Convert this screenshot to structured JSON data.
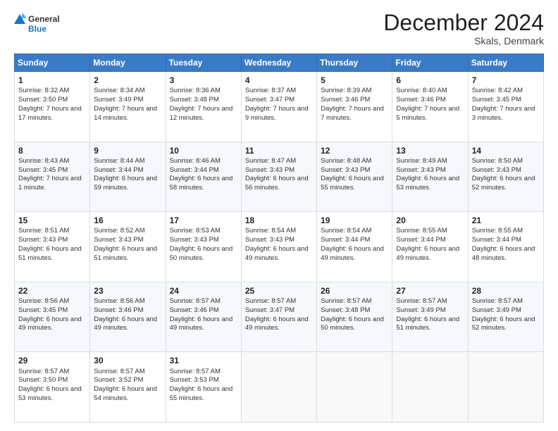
{
  "logo": {
    "line1": "General",
    "line2": "Blue"
  },
  "header": {
    "month": "December 2024",
    "location": "Skals, Denmark"
  },
  "days": [
    "Sunday",
    "Monday",
    "Tuesday",
    "Wednesday",
    "Thursday",
    "Friday",
    "Saturday"
  ],
  "weeks": [
    [
      {
        "day": "1",
        "sunrise": "8:32 AM",
        "sunset": "3:50 PM",
        "daylight": "7 hours and 17 minutes."
      },
      {
        "day": "2",
        "sunrise": "8:34 AM",
        "sunset": "3:49 PM",
        "daylight": "7 hours and 14 minutes."
      },
      {
        "day": "3",
        "sunrise": "8:36 AM",
        "sunset": "3:48 PM",
        "daylight": "7 hours and 12 minutes."
      },
      {
        "day": "4",
        "sunrise": "8:37 AM",
        "sunset": "3:47 PM",
        "daylight": "7 hours and 9 minutes."
      },
      {
        "day": "5",
        "sunrise": "8:39 AM",
        "sunset": "3:46 PM",
        "daylight": "7 hours and 7 minutes."
      },
      {
        "day": "6",
        "sunrise": "8:40 AM",
        "sunset": "3:46 PM",
        "daylight": "7 hours and 5 minutes."
      },
      {
        "day": "7",
        "sunrise": "8:42 AM",
        "sunset": "3:45 PM",
        "daylight": "7 hours and 3 minutes."
      }
    ],
    [
      {
        "day": "8",
        "sunrise": "8:43 AM",
        "sunset": "3:45 PM",
        "daylight": "7 hours and 1 minute."
      },
      {
        "day": "9",
        "sunrise": "8:44 AM",
        "sunset": "3:44 PM",
        "daylight": "6 hours and 59 minutes."
      },
      {
        "day": "10",
        "sunrise": "8:46 AM",
        "sunset": "3:44 PM",
        "daylight": "6 hours and 58 minutes."
      },
      {
        "day": "11",
        "sunrise": "8:47 AM",
        "sunset": "3:43 PM",
        "daylight": "6 hours and 56 minutes."
      },
      {
        "day": "12",
        "sunrise": "8:48 AM",
        "sunset": "3:43 PM",
        "daylight": "6 hours and 55 minutes."
      },
      {
        "day": "13",
        "sunrise": "8:49 AM",
        "sunset": "3:43 PM",
        "daylight": "6 hours and 53 minutes."
      },
      {
        "day": "14",
        "sunrise": "8:50 AM",
        "sunset": "3:43 PM",
        "daylight": "6 hours and 52 minutes."
      }
    ],
    [
      {
        "day": "15",
        "sunrise": "8:51 AM",
        "sunset": "3:43 PM",
        "daylight": "6 hours and 51 minutes."
      },
      {
        "day": "16",
        "sunrise": "8:52 AM",
        "sunset": "3:43 PM",
        "daylight": "6 hours and 51 minutes."
      },
      {
        "day": "17",
        "sunrise": "8:53 AM",
        "sunset": "3:43 PM",
        "daylight": "6 hours and 50 minutes."
      },
      {
        "day": "18",
        "sunrise": "8:54 AM",
        "sunset": "3:43 PM",
        "daylight": "6 hours and 49 minutes."
      },
      {
        "day": "19",
        "sunrise": "8:54 AM",
        "sunset": "3:44 PM",
        "daylight": "6 hours and 49 minutes."
      },
      {
        "day": "20",
        "sunrise": "8:55 AM",
        "sunset": "3:44 PM",
        "daylight": "6 hours and 49 minutes."
      },
      {
        "day": "21",
        "sunrise": "8:55 AM",
        "sunset": "3:44 PM",
        "daylight": "6 hours and 48 minutes."
      }
    ],
    [
      {
        "day": "22",
        "sunrise": "8:56 AM",
        "sunset": "3:45 PM",
        "daylight": "6 hours and 49 minutes."
      },
      {
        "day": "23",
        "sunrise": "8:56 AM",
        "sunset": "3:46 PM",
        "daylight": "6 hours and 49 minutes."
      },
      {
        "day": "24",
        "sunrise": "8:57 AM",
        "sunset": "3:46 PM",
        "daylight": "6 hours and 49 minutes."
      },
      {
        "day": "25",
        "sunrise": "8:57 AM",
        "sunset": "3:47 PM",
        "daylight": "6 hours and 49 minutes."
      },
      {
        "day": "26",
        "sunrise": "8:57 AM",
        "sunset": "3:48 PM",
        "daylight": "6 hours and 50 minutes."
      },
      {
        "day": "27",
        "sunrise": "8:57 AM",
        "sunset": "3:49 PM",
        "daylight": "6 hours and 51 minutes."
      },
      {
        "day": "28",
        "sunrise": "8:57 AM",
        "sunset": "3:49 PM",
        "daylight": "6 hours and 52 minutes."
      }
    ],
    [
      {
        "day": "29",
        "sunrise": "8:57 AM",
        "sunset": "3:50 PM",
        "daylight": "6 hours and 53 minutes."
      },
      {
        "day": "30",
        "sunrise": "8:57 AM",
        "sunset": "3:52 PM",
        "daylight": "6 hours and 54 minutes."
      },
      {
        "day": "31",
        "sunrise": "8:57 AM",
        "sunset": "3:53 PM",
        "daylight": "6 hours and 55 minutes."
      },
      null,
      null,
      null,
      null
    ]
  ],
  "labels": {
    "sunrise": "Sunrise:",
    "sunset": "Sunset:",
    "daylight": "Daylight:"
  }
}
